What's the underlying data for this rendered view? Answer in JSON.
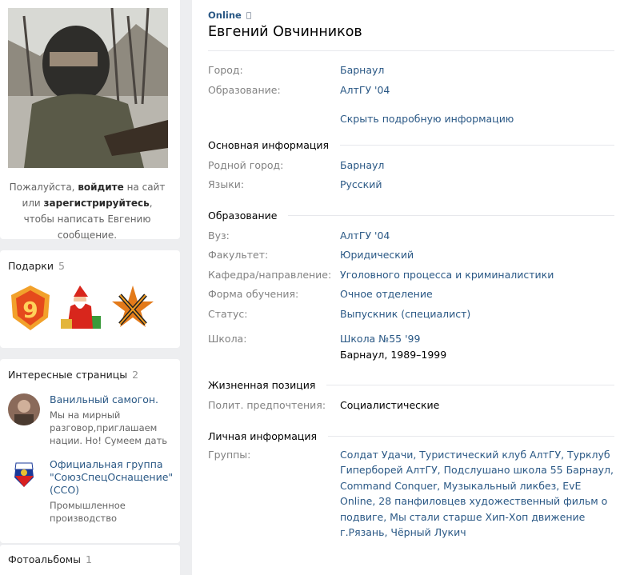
{
  "left": {
    "invite": {
      "p1": "Пожалуйста, ",
      "login": "войдите",
      "p2": " на сайт или ",
      "register": "зарегистрируйтесь",
      "p3": ", чтобы написать Евгению сообщение."
    },
    "gifts": {
      "title": "Подарки",
      "count": "5"
    },
    "pages": {
      "title": "Интересные страницы",
      "count": "2",
      "items": [
        {
          "title": "Ванильный самогон.",
          "desc": "Мы на мирный разговор,приглашаем нации. Но! Сумеем дать"
        },
        {
          "title": "Официальная группа \"СоюзСпецОснащение\" (ССО)",
          "desc": "Промышленное производство"
        }
      ]
    },
    "albums": {
      "title": "Фотоальбомы",
      "count": "1"
    }
  },
  "profile": {
    "status": "Online",
    "name": "Евгений Овчинников",
    "short": [
      {
        "label": "Город:",
        "value": "Барнаул"
      },
      {
        "label": "Образование:",
        "value": "АлтГУ '04"
      }
    ],
    "hide_link": "Скрыть подробную информацию",
    "main_info": {
      "title": "Основная информация",
      "rows": [
        {
          "label": "Родной город:",
          "value": "Барнаул"
        },
        {
          "label": "Языки:",
          "value": "Русский"
        }
      ]
    },
    "education": {
      "title": "Образование",
      "rows": [
        {
          "label": "Вуз:",
          "value": "АлтГУ '04"
        },
        {
          "label": "Факультет:",
          "value": "Юридический"
        },
        {
          "label": "Кафедра/направление:",
          "value": "Уголовного процесса и криминалистики"
        },
        {
          "label": "Форма обучения:",
          "value": "Очное отделение"
        },
        {
          "label": "Статус:",
          "value": "Выпускник (специалист)"
        }
      ],
      "school_label": "Школа:",
      "school": "Школа №55 '99",
      "school_place": "Барнаул, 1989–1999"
    },
    "position": {
      "title": "Жизненная позиция",
      "label": "Полит. предпочтения:",
      "value": "Социалистические"
    },
    "personal": {
      "title": "Личная информация",
      "label": "Группы:",
      "groups_text": "Солдат Удачи, Туристический клуб АлтГУ, Турклуб Гиперборей АлтГУ, Подслушано школа 55 Барнаул, Command Conquer, Музыкальный ликбез, EvE Online, 28 панфиловцев художественный фильм о подвиге, Мы стали старше Хип-Хоп движение г.Рязань, Чёрный Лукич"
    }
  }
}
